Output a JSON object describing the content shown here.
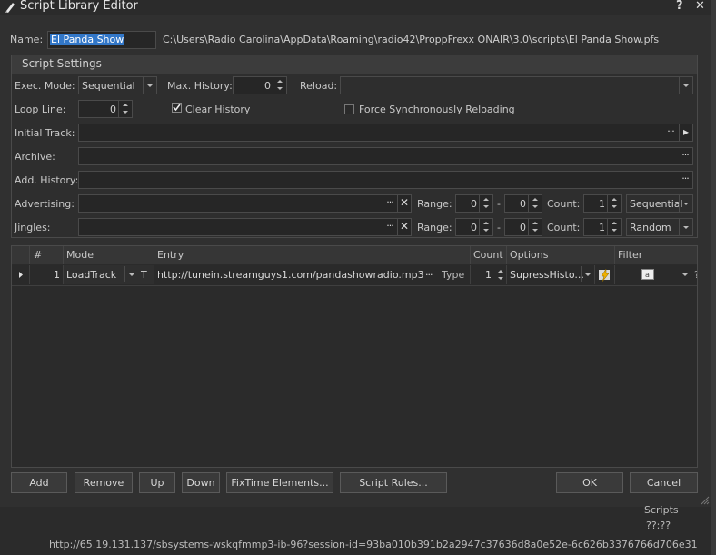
{
  "window": {
    "title": "Script Library Editor",
    "help": "?",
    "close": "✕"
  },
  "name": {
    "label": "Name:",
    "value": "El Panda Show",
    "path": "C:\\Users\\Radio Carolina\\AppData\\Roaming\\radio42\\ProppFrexx ONAIR\\3.0\\scripts\\El Panda Show.pfs"
  },
  "settings": {
    "title": "Script Settings",
    "exec_mode_label": "Exec. Mode:",
    "exec_mode_value": "Sequential",
    "max_history_label": "Max. History:",
    "max_history_value": "0",
    "reload_label": "Reload:",
    "loop_line_label": "Loop Line:",
    "loop_line_value": "0",
    "clear_history_label": "Clear History",
    "clear_history_checked": true,
    "force_sync_label": "Force Synchronously Reloading",
    "initial_track_label": "Initial Track:",
    "archive_label": "Archive:",
    "add_history_label": "Add. History:",
    "advertising_label": "Advertising:",
    "jingles_label": "Jingles:",
    "range_label": "Range:",
    "count_label": "Count:",
    "dash": "-",
    "adv_range_from": "0",
    "adv_range_to": "0",
    "adv_count": "1",
    "adv_mode": "Sequential",
    "jin_range_from": "0",
    "jin_range_to": "0",
    "jin_count": "1",
    "jin_mode": "Random"
  },
  "grid": {
    "columns": [
      "#",
      "Mode",
      "Entry",
      "Count",
      "Options",
      "Filter"
    ],
    "rows": [
      {
        "num": "1",
        "mode": "LoadTrack",
        "t": "T",
        "entry": "http://tunein.streamguys1.com/pandashowradio.mp3",
        "type": "Type",
        "count": "1",
        "options": "SupressHisto...",
        "filter_q": "?"
      }
    ]
  },
  "buttons": {
    "add": "Add",
    "remove": "Remove",
    "up": "Up",
    "down": "Down",
    "fixtime": "FixTime Elements...",
    "rules": "Script Rules...",
    "ok": "OK",
    "cancel": "Cancel"
  },
  "background": {
    "url": "http://65.19.131.137/sbsystems-wskqfmmp3-ib-96?session-id=93ba010b391b2a2947c37636d8a0e52e-6c626b3376766d706e31",
    "time": "??:??",
    "scripts": "Scripts",
    "dash": "--"
  }
}
